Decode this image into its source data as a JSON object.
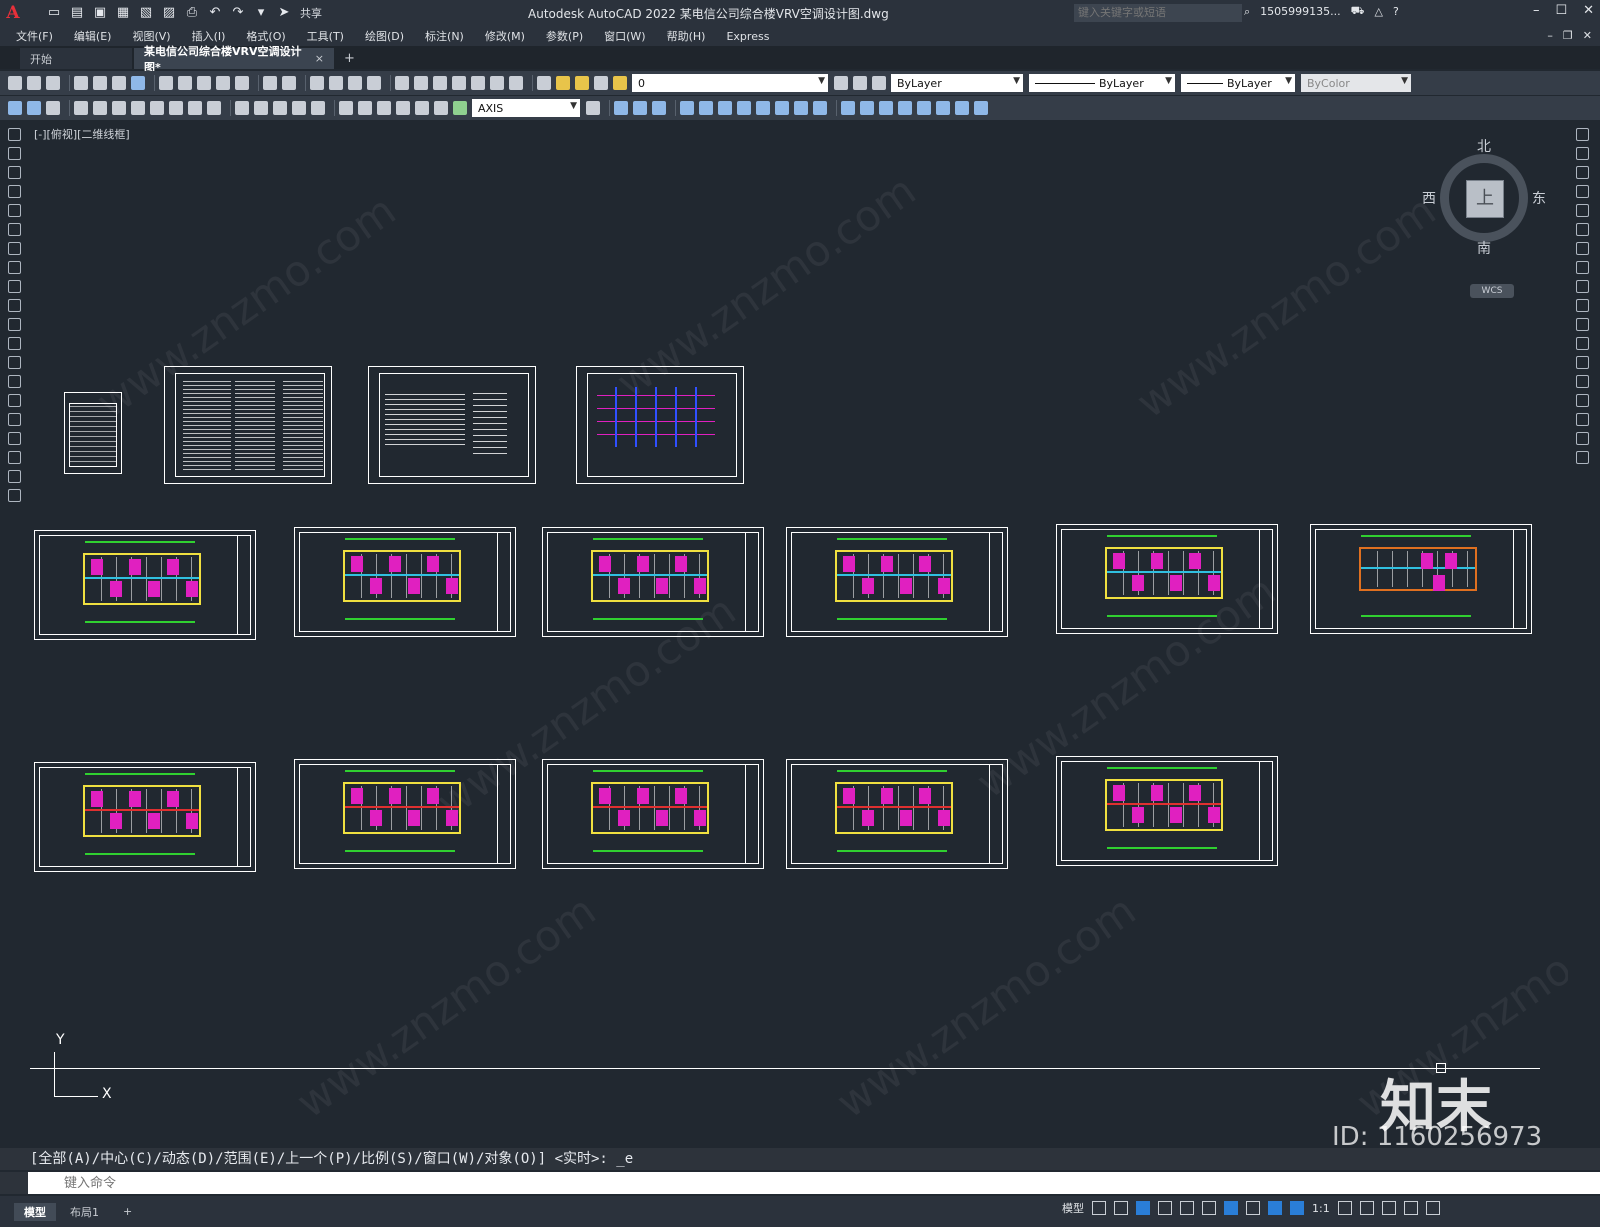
{
  "app": {
    "title": "Autodesk AutoCAD 2022    某电信公司综合楼VRV空调设计图.dwg",
    "logo": "A",
    "share": "共享",
    "search_placeholder": "键入关键字或短语",
    "user": "1505999135...",
    "help": "?"
  },
  "menu": [
    "文件(F)",
    "编辑(E)",
    "视图(V)",
    "插入(I)",
    "格式(O)",
    "工具(T)",
    "绘图(D)",
    "标注(N)",
    "修改(M)",
    "参数(P)",
    "窗口(W)",
    "帮助(H)",
    "Express"
  ],
  "tabs": {
    "start": "开始",
    "drawing": "某电信公司综合楼VRV空调设计图*",
    "close": "×",
    "add": "+"
  },
  "toolbar": {
    "layer_value": "0",
    "color_value": "ByLayer",
    "linetype_value": "ByLayer",
    "lineweight_value": "ByLayer",
    "plotstyle_value": "ByColor",
    "dimstyle_value": "AXIS"
  },
  "viewport": {
    "label": "[-][俯视][二维线框]",
    "compass": {
      "north": "北",
      "south": "南",
      "east": "东",
      "west": "西",
      "face": "上"
    },
    "wcs": "WCS",
    "ucs_x": "X",
    "ucs_y": "Y"
  },
  "command": {
    "history": "[全部(A)/中心(C)/动态(D)/范围(E)/上一个(P)/比例(S)/窗口(W)/对象(O)] <实时>: _e",
    "placeholder": "键入命令"
  },
  "status": {
    "model_tab": "模型",
    "layout_tab": "布局1",
    "add": "+",
    "model_label": "模型",
    "scale": "1:1"
  },
  "colors": {
    "background": "#212830",
    "sheet_border": "#ffffff",
    "wall": "#f0e040",
    "pipe": "#e03030",
    "unit": "#e020c0",
    "dimension": "#30d030"
  },
  "watermark": {
    "site": "www.znzmo.com",
    "brand": "知末网",
    "logo": "知末",
    "id": "ID: 1160256973"
  }
}
